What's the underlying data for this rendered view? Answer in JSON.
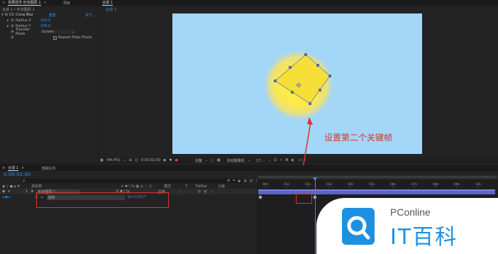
{
  "top_tabs": {
    "effect_controls_label": "效果控件 形状图层 1",
    "menu_icon_glyph": "≡",
    "project_label": "项目"
  },
  "effect_panel": {
    "path_label": "合成 1 • 形状图层 1",
    "effect_name": "CC Cross Blur",
    "reset_label": "重置",
    "about_label": "关于...",
    "params": [
      {
        "name": "Radius X",
        "value": "100.0"
      },
      {
        "name": "Radius Y",
        "value": "100.0"
      },
      {
        "name": "Transfer Mode",
        "value": "Screen"
      }
    ],
    "repeat_edge_label": "Repeat Edge Pixels",
    "repeat_edge_checked": true
  },
  "viewer": {
    "tab_label": "合成 1",
    "breadcrumb": "合成 1",
    "zoom": "(44.4%)",
    "timecode": "0:00:02:00",
    "resolution": "完整",
    "camera": "活动摄像机",
    "views": "1个...",
    "exposure": "+0.0",
    "background_color": "#a3d6f7",
    "square_color": "#f7df3a"
  },
  "annotation": {
    "text": "设置第二个关键帧",
    "color": "#d9342b"
  },
  "timeline": {
    "tab_label": "合成 1",
    "render_queue_label": "渲染队列",
    "timecode": "0:00:02:00",
    "search_placeholder": "ρ.",
    "columns": {
      "source_name": "源名称",
      "mode": "模式",
      "trkmat": "TrkMat",
      "parent": "父级"
    },
    "layer": {
      "index": "1",
      "name": "形状图层 1",
      "mode": "正常",
      "parent": "无"
    },
    "property": {
      "name": "旋转",
      "value": "0x+128.0°"
    },
    "ruler_labels": [
      "00s",
      "01s",
      "02s",
      "03s",
      "04s",
      "05s",
      "06s",
      "07s",
      "08s",
      "09s",
      "10s"
    ],
    "playhead_seconds": 2
  },
  "watermark": {
    "brand_top": "PConline",
    "brand_bottom": "IT百科"
  }
}
